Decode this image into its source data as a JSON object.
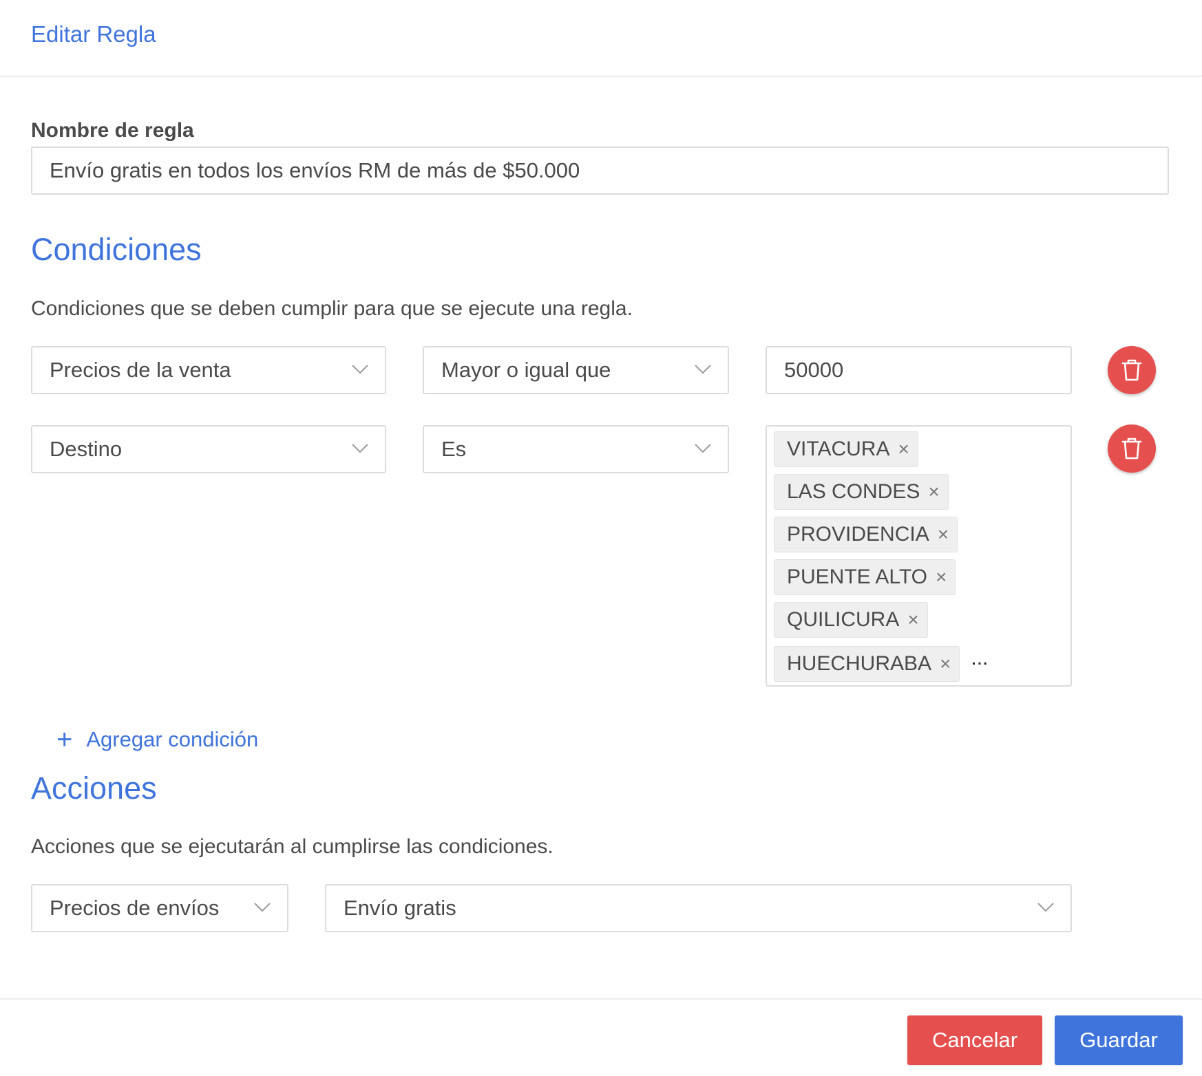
{
  "modal": {
    "title": "Editar Regla"
  },
  "rule_name": {
    "label": "Nombre de regla",
    "value": "Envío gratis en todos los envíos RM de más de $50.000"
  },
  "conditions": {
    "title": "Condiciones",
    "description": "Condiciones que se deben cumplir para que se ejecute una regla.",
    "rows": [
      {
        "field": "Precios de la venta",
        "operator": "Mayor o igual que",
        "value": "50000"
      },
      {
        "field": "Destino",
        "operator": "Es",
        "tags": [
          "VITACURA",
          "LAS CONDES",
          "PROVIDENCIA",
          "PUENTE ALTO",
          "QUILICURA",
          "HUECHURABA"
        ],
        "overflow": "..."
      }
    ],
    "add_label": "Agregar condición",
    "add_icon": "+"
  },
  "actions": {
    "title": "Acciones",
    "description": "Acciones que se ejecutarán al cumplirse las condiciones.",
    "type": "Precios de envíos",
    "value": "Envío gratis"
  },
  "footer": {
    "cancel_label": "Cancelar",
    "save_label": "Guardar"
  },
  "colors": {
    "accent": "#3f74dc",
    "danger": "#e5504f"
  }
}
